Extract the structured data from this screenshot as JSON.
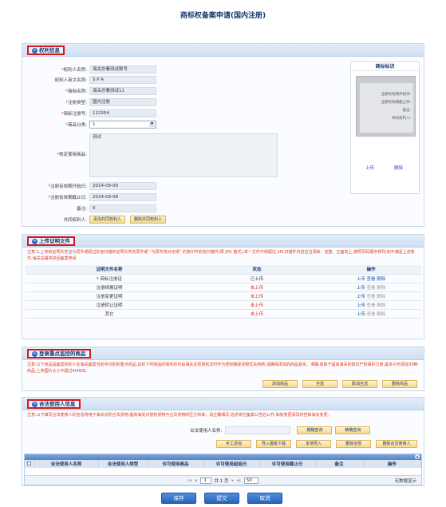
{
  "page_title": "商标权备案申请(国内注册)",
  "sections": {
    "rights": "权利信息",
    "proof": "上传证明文件",
    "monitor": "登录重点监控的商品",
    "licensee": "合法使用人信息"
  },
  "rights": {
    "owner_name_label": "权利人名称:",
    "owner_name": "海关总署测试账号",
    "owner_en_label": "权利人英文名称:",
    "owner_en": "S P A",
    "mark_name_label": "商标名称:",
    "mark_name": "海关总署测试11",
    "reg_type_label": "注册类型:",
    "reg_type": "国内注册",
    "reg_no_label": "商标注册号:",
    "reg_no": "112264",
    "class_label": "商品分类:",
    "class_value": "1",
    "goods_label": "核定使用商品:",
    "goods_value": "测试",
    "start_label": "注册有效期开始日:",
    "start_date": "2014-09-09",
    "end_label": "注册有效期截止日:",
    "end_date": "2024-09-08",
    "remark_label": "备注:",
    "remark_value": "0",
    "co_owner_label": "共同权利人:",
    "add_co_owner": "添加共同权利人",
    "del_co_owner": "删除共同权利人"
  },
  "mark_box": {
    "title": "商标标识",
    "line1": "注册有效期开始日:",
    "line2": "注册有效期截止日:",
    "line3": "备注:",
    "line4": "共同权利人:",
    "upload": "上传",
    "delete": "删除"
  },
  "proof_note": "注意:1.上传的证明文件应为原件或经过彩色扫描的证明文件的原件或 “与原件核对无误” 的复印件彩色扫描件(限 JPG 格式),单一文件不得超过 2M,扫描件内容应当清晰、完整、正面向上,按照页码顺序排列;如不满足上述条件,海关总署将驳回备案申请",
  "proof_table": {
    "headers": [
      "证明文件名称",
      "状态",
      "操作"
    ],
    "rows": [
      {
        "name": "* 商标注册证",
        "status": "已上传",
        "ops": [
          "上传",
          "查看",
          "删除"
        ]
      },
      {
        "name": "注册续展证明",
        "status": "未上传",
        "ops": [
          "上传",
          "查看",
          "删除"
        ]
      },
      {
        "name": "注册变更证明",
        "status": "未上传",
        "ops": [
          "上传",
          "查看",
          "删除"
        ]
      },
      {
        "name": "注册转让证明",
        "status": "未上传",
        "ops": [
          "上传",
          "查看",
          "删除"
        ]
      },
      {
        "name": "其它",
        "status": "未上传",
        "ops": [
          "上传",
          "查看",
          "删除"
        ]
      }
    ]
  },
  "monitor_note": "注意:以下商品是备案权利人在海关备案当前中识别的重点商品,具有下列商品的情形的可由海关在现场执法时作为侵权嫌疑货物优先判断;请确保添加的商品真实、准确,有助于提高海关的知识产权保护力度,最多只可添加30种商品,上传图片大小不超过400KB。",
  "monitor_buttons": [
    "添加商品",
    "全选",
    "取消全选",
    "删除商品"
  ],
  "licensee_note": "注意:以下填写合法使用人的信息将用于海关识别合法货物,提高海关对侵权货物与合法货物的区分效率。请正确填写,信息将在备案公告后公开,如有变更请及时告知海关变更。",
  "licensee_search": {
    "label": "合法使用人名称:",
    "value": "",
    "fuzzy": "模糊查询",
    "exact": "精确查询"
  },
  "licensee_buttons": [
    "手工添加",
    "导入模板下载",
    "本地导入",
    "删除全部",
    "删除合法使用人"
  ],
  "grid": {
    "headers": [
      "合法使用人名称",
      "合法使用人类型",
      "许可使用商品",
      "许可使用起始日",
      "许可使用截止日",
      "备注",
      "操作"
    ],
    "page_size": "50",
    "page_current": "1",
    "page_total_label": "共 1 页",
    "empty": "无数据显示"
  },
  "footer_buttons": [
    "保存",
    "提交",
    "取消"
  ]
}
